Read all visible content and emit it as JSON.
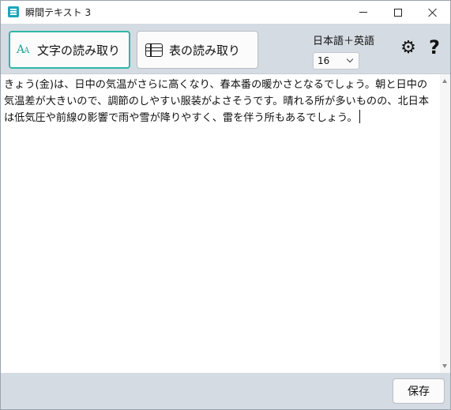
{
  "window": {
    "title": "瞬間テキスト 3",
    "icon": "app-icon"
  },
  "toolbar": {
    "text_read_label": "文字の読み取り",
    "text_read_icon": "text-aa-icon",
    "table_read_label": "表の読み取り",
    "table_read_icon": "table-icon",
    "language": "日本語＋英語",
    "font_size": "16",
    "settings_icon": "gear-icon",
    "help_icon": "help-icon"
  },
  "editor": {
    "text": "きょう(金)は、日中の気温がさらに高くなり、春本番の暖かさとなるでしょう。朝と日中の気温差が大きいので、調節のしやすい服装がよさそうです。晴れる所が多いものの、北日本は低気圧や前線の影響で雨や雪が降りやすく、雷を伴う所もあるでしょう。"
  },
  "footer": {
    "save_label": "保存"
  },
  "colors": {
    "accent": "#2fb7a8",
    "toolbar_bg": "#d5dbe2"
  }
}
